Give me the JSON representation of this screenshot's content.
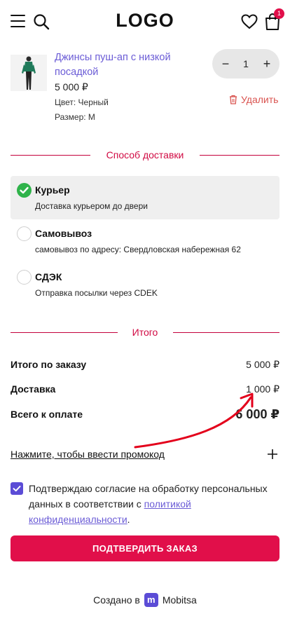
{
  "header": {
    "logo": "LOGO",
    "cart_count": "1"
  },
  "product": {
    "name": "Джинсы пуш-ап с низкой посадкой",
    "price": "5 000 ₽",
    "color": "Цвет: Черный",
    "size": "Размер: M",
    "quantity": "1",
    "minus": "−",
    "plus": "+",
    "delete_label": "Удалить"
  },
  "delivery": {
    "title": "Способ доставки",
    "options": [
      {
        "title": "Курьер",
        "desc": "Доставка курьером до двери",
        "selected": true
      },
      {
        "title": "Самовывоз",
        "desc": "самовывоз по адресу: Свердловская набережная 62",
        "selected": false
      },
      {
        "title": "СДЭК",
        "desc": "Отправка посылки через CDEK",
        "selected": false
      }
    ]
  },
  "totals": {
    "title": "Итого",
    "order_label": "Итого по заказу",
    "order_value": "5 000 ₽",
    "delivery_label": "Доставка",
    "delivery_value": "1 000 ₽",
    "grand_label": "Всего к оплате",
    "grand_value": "6 000 ₽"
  },
  "promo": {
    "label": "Нажмите, чтобы ввести промокод"
  },
  "consent": {
    "checked": true,
    "text_before": "Подтверждаю согласие на обработку персональных данных в соответствии с ",
    "link": "политикой конфиденциальности",
    "text_after": "."
  },
  "confirm_button": "ПОДТВЕРДИТЬ ЗАКАЗ",
  "footer": {
    "created_by": "Создано в",
    "brand": "Mobitsa",
    "brand_letter": "m"
  },
  "colors": {
    "accent": "#e10f4a",
    "link": "#6b5cd6",
    "success": "#2fb34a"
  }
}
